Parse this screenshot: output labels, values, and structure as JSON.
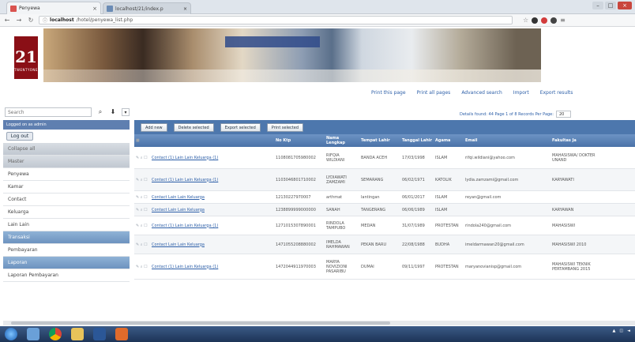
{
  "browser": {
    "tab1_title": "Penyewa",
    "tab2_title": "localhost/21/index.p",
    "url_host": "localhost",
    "url_path": "/hotel/penyewa_list.php"
  },
  "logo": {
    "number": "21",
    "subtitle": "TWENTYONE"
  },
  "toplinks": [
    "Print this page",
    "Print all pages",
    "Advanced search",
    "Import",
    "Export results"
  ],
  "search": {
    "placeholder": "Search"
  },
  "records": {
    "text": "Details found: 44  Page 1 of 8  Records Per Page:",
    "per_page": "20"
  },
  "sidebar": {
    "logged_in": "Logged on as admin",
    "logout": "Log out",
    "items": [
      {
        "label": "Collapse all",
        "type": "grp"
      },
      {
        "label": "Master",
        "type": "grp"
      },
      {
        "label": "Penyewa",
        "type": "item"
      },
      {
        "label": "Kamar",
        "type": "item"
      },
      {
        "label": "Contact",
        "type": "item"
      },
      {
        "label": "Keluarga",
        "type": "item"
      },
      {
        "label": "Lain Lain",
        "type": "item"
      },
      {
        "label": "Transaksi",
        "type": "grp blue"
      },
      {
        "label": "Pembayaran",
        "type": "item"
      },
      {
        "label": "Laporan",
        "type": "grp blue"
      },
      {
        "label": "Laporan Pembayaran",
        "type": "item"
      }
    ]
  },
  "buttons": {
    "add": "Add new",
    "delete": "Delete selected",
    "export": "Export selected",
    "print": "Print selected"
  },
  "table": {
    "headers": [
      "No Ktp",
      "Nama Lengkap",
      "Tempat Lahir",
      "Tanggal Lahir",
      "Agama",
      "Email",
      "Fakultas Ja"
    ],
    "rows": [
      {
        "actions": "Contact (1)  Lain Lain  Keluarga (1)",
        "nik": "1108081705980002",
        "nama": "RIFQIA WILDIANI",
        "tempat": "BANDA ACEH",
        "tgl": "17/03/1998",
        "agama": "ISLAM",
        "email": "rifqi.wildiani@yahoo.com",
        "fak": "MAHASISWA/ DOKTER UNAND"
      },
      {
        "actions": "Contact (1)  Lain Lain  Keluarga (1)",
        "nik": "1103046801710002",
        "nama": "LYDIAWATI ZAMZAMI",
        "tempat": "SEMARANG",
        "tgl": "06/02/1971",
        "agama": "KATOLIK",
        "email": "lydia.zamzami@gmail.com",
        "fak": "KARYAWATI"
      },
      {
        "actions": "Contact  Lain Lain  Keluarga",
        "nik": "12130227970007",
        "nama": "arthmat",
        "tempat": "lantingan",
        "tgl": "06/01/2017",
        "agama": "ISLAM",
        "email": "reyan@gmail.com",
        "fak": ""
      },
      {
        "actions": "Contact  Lain Lain  Keluarga",
        "nik": "1238899999000000",
        "nama": "SANAH",
        "tempat": "TANGERANG",
        "tgl": "06/06/1989",
        "agama": "ISLAM",
        "email": "",
        "fak": "KARYAWAN"
      },
      {
        "actions": "Contact (1)  Lain Lain  Keluarga (1)",
        "nik": "1271015307890001",
        "nama": "RINDOLA TAMPUBO",
        "tempat": "MEDAN",
        "tgl": "31/07/1989",
        "agama": "PROTESTAN",
        "email": "rindola240@gmail.com",
        "fak": "MAHASISWI"
      },
      {
        "actions": "Contact  Lain Lain  Keluarga",
        "nik": "1471055208880002",
        "nama": "IMELDA RAHMAWAN",
        "tempat": "PEKAN BARU",
        "tgl": "22/08/1988",
        "agama": "BUDHA",
        "email": "imeldarmawan20@gmail.com",
        "fak": "MAHASISWI 2010"
      },
      {
        "actions": "Contact (1)  Lain Lain  Keluarga (1)",
        "nik": "1472044911970003",
        "nama": "MARYA NOVIZIONI PASARIBU",
        "tempat": "DUMAI",
        "tgl": "09/11/1997",
        "agama": "PROTESTAN",
        "email": "maryanovianisp@gmail.com",
        "fak": "MAHASISWI TEKNIK PERTAMBANG 2015"
      }
    ]
  }
}
